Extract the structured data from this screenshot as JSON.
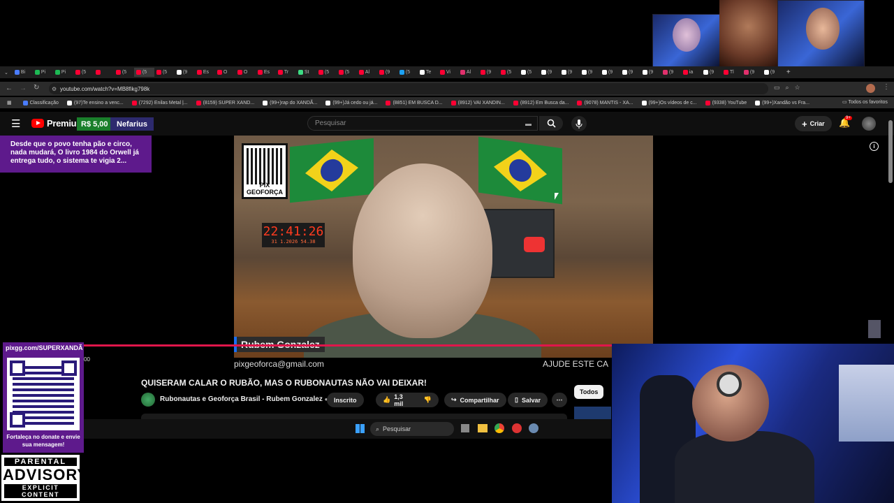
{
  "browser": {
    "url": "youtube.com/watch?v=MB8fikg798k",
    "tab_favicon_colors": [
      "#4a7cff",
      "#1db954",
      "#1db954",
      "#ff0033",
      "#ff0033",
      "#ff0033",
      "#ff0033",
      "#ff0033",
      "#ffffff",
      "#ff0033",
      "#ff0033",
      "#ff0033",
      "#ff0033",
      "#ff0033",
      "#3ddc84",
      "#ff0033",
      "#ff0033",
      "#ff0033",
      "#ff0033",
      "#1da1f2",
      "#ffffff",
      "#ff0033",
      "#e1306c",
      "#ff0033",
      "#ff0033",
      "#ffffff",
      "#ffffff",
      "#ffffff",
      "#ffffff",
      "#ffffff",
      "#ffffff",
      "#ffffff",
      "#e1306c",
      "#ff0033",
      "#ffffff",
      "#ff0033",
      "#e1306c",
      "#ffffff"
    ],
    "tab_label_texts": [
      "Bi",
      "Pi",
      "Pi",
      "(5",
      "",
      "(5",
      "(5",
      "(5",
      "(9",
      "Es",
      "O",
      "O",
      "Es",
      "Tr",
      "St",
      "(5",
      "(5",
      "Al",
      "(9",
      "(5",
      "Te",
      "Vi",
      "Al",
      "(9",
      "(5",
      "(5",
      "(9",
      "(9",
      "(9",
      "(9",
      "(9",
      "(9",
      "(9",
      "ia",
      "(9",
      "Tl",
      "(9",
      "(9"
    ],
    "bookmarks": [
      {
        "label": "Classificação",
        "color": "#4a7cff"
      },
      {
        "label": "(97)Te ensino a venc...",
        "color": "#ffffff"
      },
      {
        "label": "(7292) Enilas Metal |...",
        "color": "#ff0033"
      },
      {
        "label": "(8159) SUPER XAND...",
        "color": "#ff0033"
      },
      {
        "label": "(99+)rap do XANDÃ...",
        "color": "#ffffff"
      },
      {
        "label": "(99+)Já cedo ou já...",
        "color": "#ffffff"
      },
      {
        "label": "(8851) EM BUSCA D...",
        "color": "#ff0033"
      },
      {
        "label": "(8912) VAI XANDIN...",
        "color": "#ff0033"
      },
      {
        "label": "(8912) Em Busca da...",
        "color": "#ff0033"
      },
      {
        "label": "(9078) MANTIS - XA...",
        "color": "#ff0033"
      },
      {
        "label": "(99+)Os vídeos de c...",
        "color": "#ffffff"
      },
      {
        "label": "(9338) YouTube",
        "color": "#ff0033"
      },
      {
        "label": "(99+)Xandão vs Fra...",
        "color": "#ffffff"
      }
    ],
    "bookmarks_all": "Todos os favoritos"
  },
  "youtube": {
    "logo_text": "Premium",
    "superchat_amount": "R$ 5,00",
    "superchat_user": "Nefarius",
    "search_placeholder": "Pesquisar",
    "create_label": "Criar",
    "notification_count": "9+",
    "video_title": "QUISERAM CALAR O RUBÃO, MAS O RUBONAUTAS NÃO VAI DEIXAR!",
    "channel_name": "Rubonautas e Geoforça Brasil - Rubem Gonzalez",
    "subscribe_label": "Inscrito",
    "likes": "1,3 mil",
    "share_label": "Compartilhar",
    "save_label": "Salvar",
    "filter_chip": "Todos",
    "time_fragment": "00"
  },
  "video": {
    "qr_label": "PIX GEOFORÇA",
    "clock_time": "22:41:26",
    "clock_sub": "31  1.2026     54.38",
    "lower_third_name": "Rubem Gonzalez",
    "email": "pixgeoforca@gmail.com",
    "ticker": "AJUDE ESTE CA"
  },
  "overlay": {
    "superchat_message": "Desde que o povo tenha pão e circo, nada mudará, O livro 1984 do Orwell já entrega tudo, o sistema te vigia 2...",
    "pix_url": "pixgg.com/SUPERXANDÃ",
    "pix_message": "Fortaleça no donate e envie sua mensagem!",
    "advisory_top": "PARENTAL",
    "advisory_mid": "ADVISORY",
    "advisory_bottom": "EXPLICIT CONTENT"
  },
  "taskbar": {
    "search_placeholder": "Pesquisar"
  },
  "colors": {
    "youtube_red": "#ff0000",
    "superchat_green": "#1a7f2b",
    "purple": "#5e1a8c",
    "progress_red": "#e0164b"
  }
}
